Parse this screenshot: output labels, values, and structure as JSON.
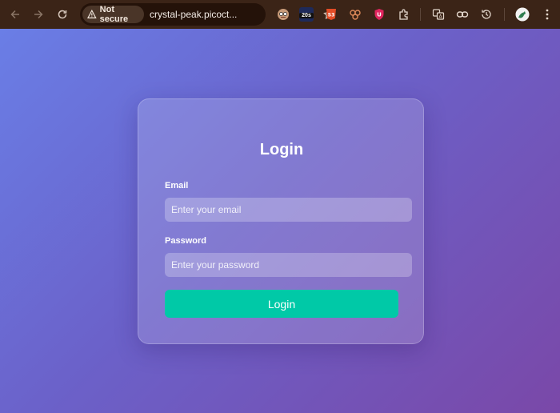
{
  "browser": {
    "security_label": "Not secure",
    "url": "crystal-peak.picoct...",
    "extensions": [
      {
        "icon": "avatar-extension-icon"
      },
      {
        "icon": "timer-extension-icon",
        "badge": "20s"
      },
      {
        "icon": "html5-extension-icon"
      },
      {
        "icon": "cookie-extension-icon"
      },
      {
        "icon": "shield-extension-icon"
      },
      {
        "icon": "puzzle-icon"
      },
      {
        "icon": "translate-icon"
      },
      {
        "icon": "link-icon"
      },
      {
        "icon": "history-icon"
      },
      {
        "icon": "profile-avatar-icon"
      },
      {
        "icon": "more-menu-icon"
      }
    ]
  },
  "login": {
    "title": "Login",
    "email_label": "Email",
    "email_placeholder": "Enter your email",
    "password_label": "Password",
    "password_placeholder": "Enter your password",
    "submit_label": "Login"
  },
  "colors": {
    "toolbar": "#3b2417",
    "gradient_start": "#6a7ee6",
    "gradient_end": "#7a48a8",
    "button": "#00c9a7"
  }
}
